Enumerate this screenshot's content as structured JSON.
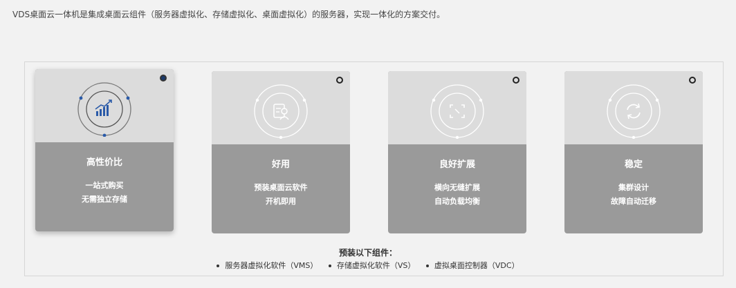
{
  "intro_text": "VDS桌面云一体机是集成桌面云组件（服务器虚拟化、存储虚拟化、桌面虚拟化）的服务器，实现一体化的方案交付。",
  "cards": [
    {
      "title": "高性价比",
      "line1": "一站式购买",
      "line2": "无需独立存储",
      "icon": "chart-up-icon",
      "selected": true
    },
    {
      "title": "好用",
      "line1": "预装桌面云软件",
      "line2": "开机即用",
      "icon": "document-user-icon",
      "selected": false
    },
    {
      "title": "良好扩展",
      "line1": "横向无缝扩展",
      "line2": "自动负载均衡",
      "icon": "expand-frame-icon",
      "selected": false
    },
    {
      "title": "稳定",
      "line1": "集群设计",
      "line2": "故障自动迁移",
      "icon": "refresh-cycle-icon",
      "selected": false
    }
  ],
  "components": {
    "title": "预装以下组件：",
    "items": [
      "服务器虚拟化软件（VMS）",
      "存储虚拟化软件（VS）",
      "虚拟桌面控制器（VDC）"
    ]
  },
  "colors": {
    "accent": "#2a5aa8",
    "card_top": "#dcdcdc",
    "card_bottom": "#9a9a9a"
  }
}
